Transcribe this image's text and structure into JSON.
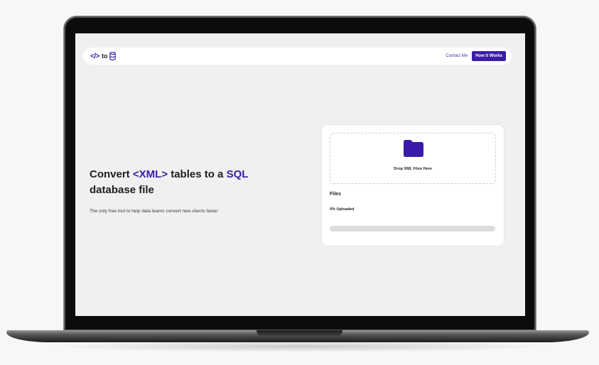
{
  "nav": {
    "logo_code": "</>",
    "logo_to": "to",
    "contact_label": "Contact Me",
    "how_label": "How it Works"
  },
  "hero": {
    "line1_prefix": "Convert ",
    "line1_xml": "<XML>",
    "line1_mid": " tables to a ",
    "line1_sql": "SQL",
    "line2": "database file",
    "subtitle": "The only free tool to help data teams convert new clients faster"
  },
  "upload": {
    "drop_label": "Drop XML Files Here",
    "files_title": "Files",
    "status": "0% Uploaded",
    "progress_fraction": 0
  },
  "colors": {
    "brand": "#3a1ca8",
    "screen_bg": "#f0f0f0",
    "card_bg": "#ffffff",
    "track": "#dcdcdc"
  },
  "icons": [
    "code-icon",
    "database-icon",
    "folder-icon"
  ]
}
